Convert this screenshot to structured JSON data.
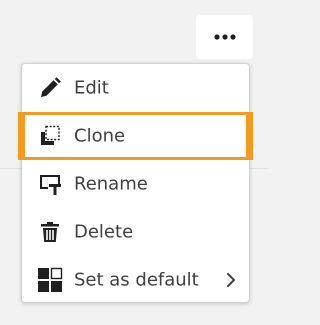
{
  "more_button": {
    "icon": "more-horizontal-icon"
  },
  "menu": {
    "items": [
      {
        "label": "Edit",
        "icon": "pencil-icon"
      },
      {
        "label": "Clone",
        "icon": "clone-icon",
        "focused": true
      },
      {
        "label": "Rename",
        "icon": "rename-icon"
      },
      {
        "label": "Delete",
        "icon": "trash-icon"
      },
      {
        "label": "Set as default",
        "icon": "set-default-icon",
        "submenu_icon": "chevron-right-icon"
      }
    ]
  },
  "colors": {
    "background": "#f2f2f2",
    "menu_background": "#ffffff",
    "text": "#404040",
    "icon": "#202020",
    "focus_outline": "#f39a1f"
  }
}
